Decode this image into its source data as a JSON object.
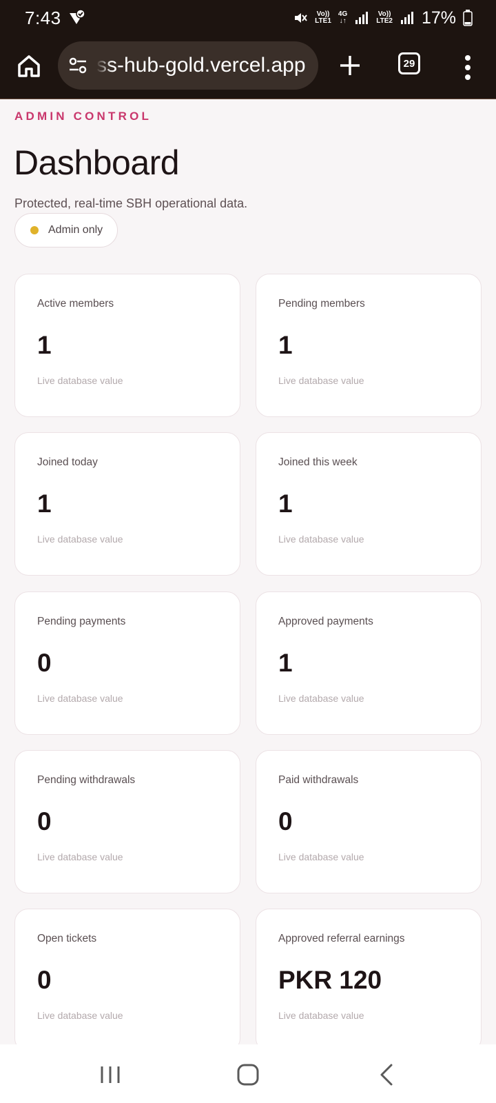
{
  "status_bar": {
    "time": "7:43",
    "sim1_label_top": "Vo))",
    "sim1_label_bottom": "LTE1",
    "net_label": "4G",
    "sim2_label_top": "Vo))",
    "sim2_label_bottom": "LTE2",
    "battery": "17%"
  },
  "browser": {
    "url": "ss-hub-gold.vercel.app",
    "tab_count": "29"
  },
  "page": {
    "eyebrow": "ADMIN CONTROL",
    "title": "Dashboard",
    "subtitle": "Protected, real-time SBH operational data.",
    "badge": "Admin only"
  },
  "cards": [
    {
      "label": "Active members",
      "value": "1",
      "sub": "Live database value"
    },
    {
      "label": "Pending members",
      "value": "1",
      "sub": "Live database value"
    },
    {
      "label": "Joined today",
      "value": "1",
      "sub": "Live database value"
    },
    {
      "label": "Joined this week",
      "value": "1",
      "sub": "Live database value"
    },
    {
      "label": "Pending payments",
      "value": "0",
      "sub": "Live database value"
    },
    {
      "label": "Approved payments",
      "value": "1",
      "sub": "Live database value"
    },
    {
      "label": "Pending withdrawals",
      "value": "0",
      "sub": "Live database value"
    },
    {
      "label": "Paid withdrawals",
      "value": "0",
      "sub": "Live database value"
    },
    {
      "label": "Open tickets",
      "value": "0",
      "sub": "Live database value"
    },
    {
      "label": "Approved referral earnings",
      "value": "PKR 120",
      "sub": "Live database value"
    }
  ],
  "colors": {
    "accent": "#c9376c",
    "badge_dot": "#e0b22a",
    "browser_bg": "#1d1410"
  }
}
